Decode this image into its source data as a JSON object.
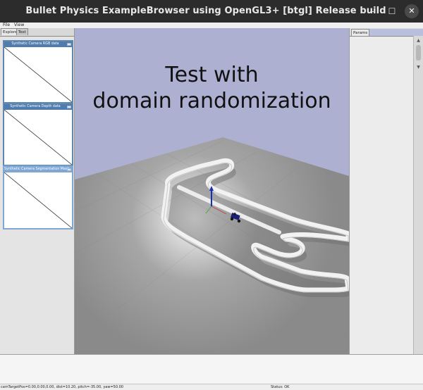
{
  "window": {
    "title": "Bullet Physics ExampleBrowser using OpenGL3+ [btgl] Release build",
    "controls": {
      "minimize": "–",
      "maximize": "☐",
      "close": "✕"
    }
  },
  "menu": {
    "items": [
      "File",
      "View"
    ]
  },
  "left_panel": {
    "tabs": [
      "Explorer",
      "Test"
    ],
    "active_tab": "Explorer",
    "camera_windows": [
      {
        "title": "Synthetic Camera RGB data"
      },
      {
        "title": "Synthetic Camera Depth data"
      },
      {
        "title": "Synthetic Camera Segmentation Mask"
      }
    ]
  },
  "viewport": {
    "overlay_line1": "Test with",
    "overlay_line2": "domain randomization",
    "colors": {
      "sky": "#aeb0d2",
      "floor": "#8e8e8e",
      "track": "#f2f2f2"
    }
  },
  "right_panel": {
    "tab": "Params"
  },
  "status": {
    "camera": "camTargetPos=0.00,0.00,0.00, dist=10.20, pitch=-35.00, yaw=50.00",
    "status_text": "Status: OK"
  }
}
